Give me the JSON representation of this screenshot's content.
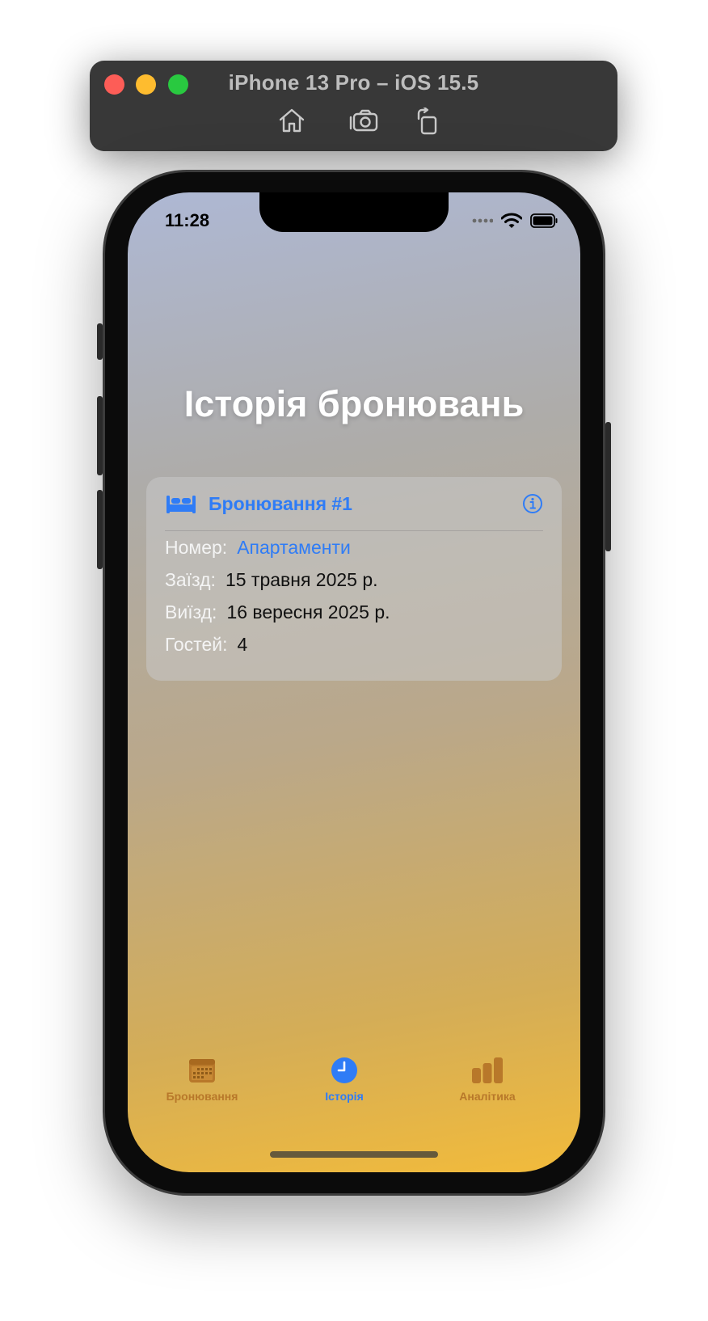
{
  "simulator": {
    "title": "iPhone 13 Pro – iOS 15.5",
    "toolbar_icons": [
      "home-icon",
      "screenshot-icon",
      "rotate-icon"
    ]
  },
  "status_bar": {
    "time": "11:28",
    "icons": [
      "signal-dots-icon",
      "wifi-icon",
      "battery-icon"
    ]
  },
  "page": {
    "title": "Історія бронювань"
  },
  "booking_card": {
    "icon": "bed-icon",
    "title": "Бронювання #1",
    "info_icon": "info-icon",
    "rows": [
      {
        "label": "Номер:",
        "value": "Апартаменти"
      },
      {
        "label": "Заїзд:",
        "value": "15 травня 2025 р."
      },
      {
        "label": "Виїзд:",
        "value": "16 вересня 2025 р."
      },
      {
        "label": "Гостей:",
        "value": "4"
      }
    ]
  },
  "tab_bar": {
    "tabs": [
      {
        "label": "Бронювання",
        "icon": "calendar-icon",
        "selected": false
      },
      {
        "label": "Історія",
        "icon": "clock-icon",
        "selected": true
      },
      {
        "label": "Аналітика",
        "icon": "bar-chart-icon",
        "selected": false
      }
    ]
  },
  "colors": {
    "accent": "#2f7cf6",
    "inactive_tab": "#b8782a",
    "gradient_top": "#aeb8d4",
    "gradient_bottom": "#f2bb3b"
  }
}
